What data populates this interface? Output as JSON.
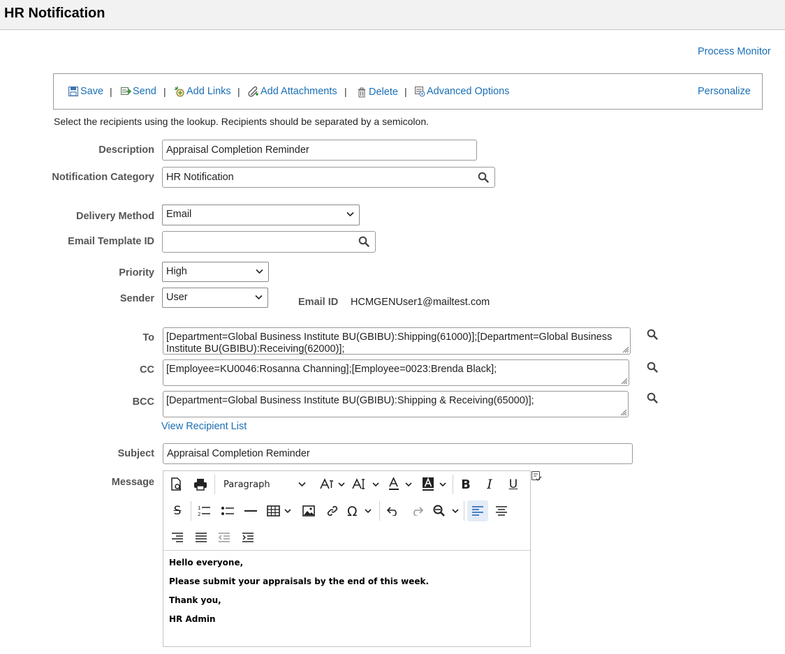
{
  "page": {
    "title": "HR Notification"
  },
  "links": {
    "process_monitor": "Process Monitor"
  },
  "toolbar": {
    "save": "Save",
    "send": "Send",
    "add_links": "Add Links",
    "add_attachments": "Add Attachments",
    "delete": "Delete",
    "advanced_options": "Advanced Options",
    "personalize": "Personalize",
    "separator": "|"
  },
  "instructions": "Select the recipients using the lookup. Recipients should be separated by a semicolon.",
  "form": {
    "description": {
      "label": "Description",
      "value": "Appraisal Completion Reminder"
    },
    "notification_category": {
      "label": "Notification Category",
      "value": "HR Notification"
    },
    "delivery_method": {
      "label": "Delivery Method",
      "value": "Email"
    },
    "email_template_id": {
      "label": "Email Template ID",
      "value": ""
    },
    "priority": {
      "label": "Priority",
      "value": "High"
    },
    "sender": {
      "label": "Sender",
      "value": "User"
    },
    "email_id": {
      "label": "Email ID",
      "value": "HCMGENUser1@mailtest.com"
    },
    "to": {
      "label": "To",
      "value": "[Department=Global Business Institute BU(GBIBU):Shipping(61000)];[Department=Global Business Institute BU(GBIBU):Receiving(62000)];"
    },
    "cc": {
      "label": "CC",
      "value": "[Employee=KU0046:Rosanna Channing];[Employee=0023:Brenda Black];"
    },
    "bcc": {
      "label": "BCC",
      "value": "[Department=Global Business Institute BU(GBIBU):Shipping & Receiving(65000)];"
    },
    "view_recipient_list": "View Recipient List",
    "subject": {
      "label": "Subject",
      "value": "Appraisal Completion Reminder"
    },
    "message": {
      "label": "Message"
    }
  },
  "editor": {
    "paragraph_format": "Paragraph",
    "content": [
      "Hello everyone,",
      "Please submit your appraisals by the end of this week.",
      "Thank you,",
      "HR Admin"
    ]
  },
  "colors": {
    "link": "#1a6fb5",
    "title_bar": "#f2f2f2",
    "label": "#555555"
  }
}
